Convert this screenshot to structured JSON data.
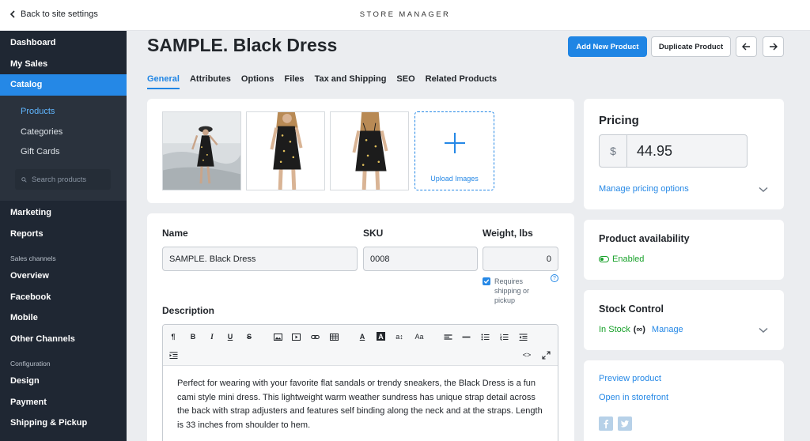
{
  "topbar": {
    "back_label": "Back to site settings",
    "store_title": "STORE MANAGER"
  },
  "sidebar": {
    "items_top": [
      {
        "label": "Dashboard"
      },
      {
        "label": "My Sales"
      },
      {
        "label": "Catalog",
        "active": true
      }
    ],
    "catalog_sub": [
      {
        "label": "Products",
        "active": true
      },
      {
        "label": "Categories"
      },
      {
        "label": "Gift Cards"
      }
    ],
    "search_placeholder": "Search products",
    "items_mid": [
      {
        "label": "Marketing"
      },
      {
        "label": "Reports"
      }
    ],
    "sales_channels_label": "Sales channels",
    "channels": [
      {
        "label": "Overview"
      },
      {
        "label": "Facebook"
      },
      {
        "label": "Mobile"
      },
      {
        "label": "Other Channels"
      }
    ],
    "configuration_label": "Configuration",
    "config": [
      {
        "label": "Design"
      },
      {
        "label": "Payment"
      },
      {
        "label": "Shipping & Pickup"
      }
    ]
  },
  "product": {
    "title": "SAMPLE. Black Dress",
    "add_new_label": "Add New Product",
    "duplicate_label": "Duplicate Product"
  },
  "tabs": [
    {
      "label": "General",
      "active": true
    },
    {
      "label": "Attributes"
    },
    {
      "label": "Options"
    },
    {
      "label": "Files"
    },
    {
      "label": "Tax and Shipping"
    },
    {
      "label": "SEO"
    },
    {
      "label": "Related Products"
    }
  ],
  "images": {
    "upload_label": "Upload Images"
  },
  "details": {
    "name_label": "Name",
    "name_value": "SAMPLE. Black Dress",
    "sku_label": "SKU",
    "sku_value": "0008",
    "weight_label": "Weight, lbs",
    "weight_value": "0",
    "requires_shipping_label": "Requires shipping or pickup",
    "help_glyph": "?",
    "description_label": "Description",
    "description_text": "Perfect for wearing with your favorite flat sandals or trendy sneakers, the Black Dress is a fun cami style mini dress. This lightweight warm weather sundress has unique strap detail across the back with strap adjusters and features self binding along the neck and at the straps. Length is 33 inches from shoulder to hem."
  },
  "toolbar": {
    "paragraph": "¶",
    "bold": "B",
    "italic": "I",
    "underline": "U",
    "strike": "S",
    "text_color": "A",
    "bg_color": "A",
    "font_size": "a↕",
    "font_family": "Aa",
    "code_view": "<>"
  },
  "pricing": {
    "title": "Pricing",
    "currency": "$",
    "price": "44.95",
    "manage_link": "Manage pricing options"
  },
  "availability": {
    "title": "Product availability",
    "status": "Enabled"
  },
  "stock": {
    "title": "Stock Control",
    "status": "In Stock",
    "infinity": "(∞)",
    "manage": "Manage"
  },
  "links": {
    "preview": "Preview product",
    "storefront": "Open in storefront"
  },
  "colors": {
    "accent": "#2588e6",
    "sidebar": "#1f2733",
    "success": "#18a12a"
  }
}
